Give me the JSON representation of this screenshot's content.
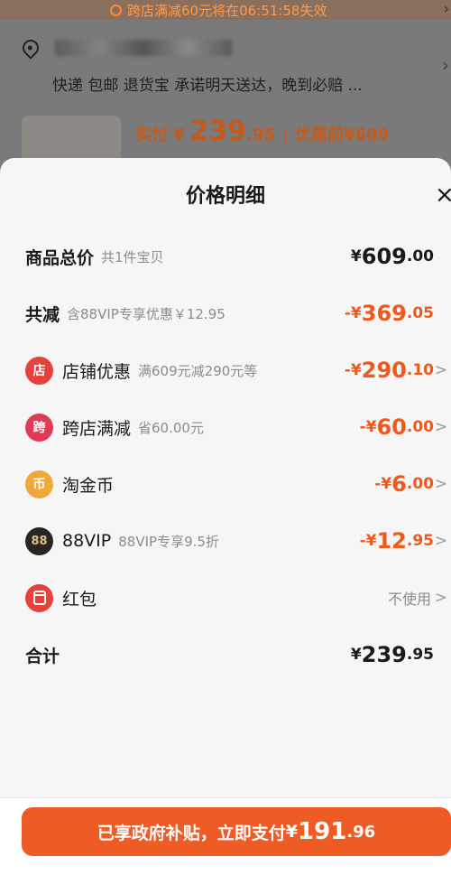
{
  "background": {
    "banner_text": "跨店满减60元将在06:51:58失效",
    "delivery_text": "快递 包邮 退货宝 承诺明天送达，晚到必赔 ...",
    "price_label": "实付",
    "price_currency": "¥",
    "price_int": "239",
    "price_dec": ".95",
    "price_sep": "|",
    "original_price": "优惠前¥609"
  },
  "sheet": {
    "title": "价格明细",
    "close": "×"
  },
  "rows": {
    "total": {
      "label": "商品总价",
      "sub": "共1件宝贝",
      "cur": "¥",
      "int": "609",
      "dec": ".00"
    },
    "reduce": {
      "label": "共减",
      "sub": "含88VIP专享优惠￥12.95",
      "cur": "-¥",
      "int": "369",
      "dec": ".05"
    },
    "shop": {
      "label": "店铺优惠",
      "sub": "满609元减290元等",
      "cur": "-¥",
      "int": "290",
      "dec": ".10",
      "icon": "店"
    },
    "cross": {
      "label": "跨店满减",
      "sub": "省60.00元",
      "cur": "-¥",
      "int": "60",
      "dec": ".00",
      "icon": "跨"
    },
    "coin": {
      "label": "淘金币",
      "sub": "",
      "cur": "-¥",
      "int": "6",
      "dec": ".00",
      "icon": "币"
    },
    "vip": {
      "label": "88VIP",
      "sub": "88VIP专享9.5折",
      "cur": "-¥",
      "int": "12",
      "dec": ".95",
      "icon": "88"
    },
    "redpack": {
      "label": "红包",
      "value": "不使用"
    },
    "sum": {
      "label": "合计",
      "cur": "¥",
      "int": "239",
      "dec": ".95"
    }
  },
  "pay": {
    "text": "已享政府补贴，立即支付",
    "cur": "¥",
    "int": "191",
    "dec": ".96"
  },
  "colors": {
    "accent": "#ef5b25",
    "discount": "#ee5a1e",
    "shop_icon": "#e8403a",
    "cross_icon": "#e03a55",
    "coin_icon": "#f0a83a",
    "vip_icon": "#2a2520",
    "redpack_icon": "#e8403a"
  },
  "icons": {
    "close": "close-icon",
    "shop": "shop-icon",
    "cross": "cross-store-icon",
    "coin": "coin-icon",
    "vip": "vip-88-icon",
    "redpack": "red-packet-icon",
    "chevron": "chevron-right-icon"
  }
}
